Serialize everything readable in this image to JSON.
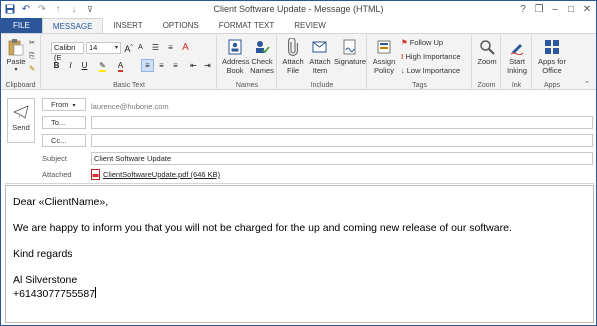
{
  "window": {
    "title": "Client Software Update - Message (HTML)",
    "controls": [
      "?",
      "❐",
      "–",
      "□",
      "✕"
    ]
  },
  "tabs": [
    {
      "label": "FILE"
    },
    {
      "label": "MESSAGE"
    },
    {
      "label": "INSERT"
    },
    {
      "label": "OPTIONS"
    },
    {
      "label": "FORMAT TEXT"
    },
    {
      "label": "REVIEW"
    }
  ],
  "ribbon": {
    "clipboard": {
      "label": "Clipboard",
      "paste": "Paste"
    },
    "basic_text": {
      "label": "Basic Text",
      "font": "Calibri (E",
      "size": "14",
      "bold": "B",
      "italic": "I",
      "underline": "U"
    },
    "names": {
      "label": "Names",
      "address_book": "Address Book",
      "check_names": "Check Names"
    },
    "include": {
      "label": "Include",
      "attach_file": "Attach File",
      "attach_item": "Attach Item",
      "signature": "Signature"
    },
    "tags": {
      "label": "Tags",
      "assign_policy": "Assign Policy",
      "follow_up": "Follow Up",
      "high": "High Importance",
      "low": "Low Importance"
    },
    "zoom": {
      "label": "Zoom",
      "zoom": "Zoom"
    },
    "ink": {
      "label": "Ink",
      "start_inking": "Start Inking"
    },
    "apps": {
      "label": "Apps",
      "apps_for_office": "Apps for Office"
    }
  },
  "header": {
    "send": "Send",
    "from_label": "From",
    "from_value": "laurence@hubone.com",
    "to_label": "To...",
    "to_value": "",
    "cc_label": "Cc...",
    "cc_value": "",
    "subject_label": "Subject",
    "subject_value": "Client Software Update",
    "attached_label": "Attached",
    "attachment": "ClientSoftwareUpdate.pdf (646 KB)"
  },
  "body": {
    "greeting": "Dear «ClientName»,",
    "paragraph": "We are happy to inform you that you will not be charged for the up and coming new release of our software.",
    "closing": "Kind regards",
    "name": "Al Silverstone",
    "phone": "+6143077755587"
  },
  "colors": {
    "accent": "#2b579a",
    "ribbon_bg": "#f3f3f3"
  }
}
